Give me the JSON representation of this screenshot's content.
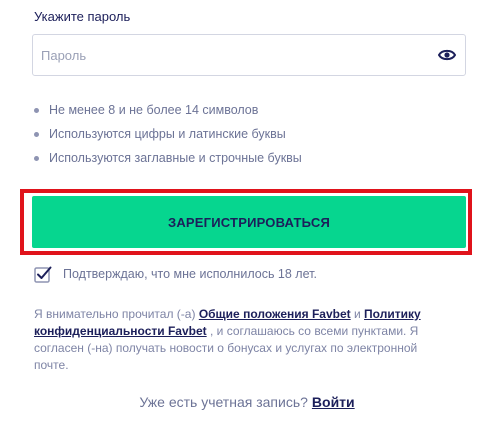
{
  "password": {
    "label": "Укажите пароль",
    "placeholder": "Пароль",
    "value": "",
    "toggle_icon": "eye-icon"
  },
  "rules": [
    "Не менее 8 и не более 14 символов",
    "Используются цифры и латинские буквы",
    "Используются заглавные и строчные буквы"
  ],
  "register_button": {
    "label": "ЗАРЕГИСТРИРОВАТЬСЯ",
    "color": "#06d68f",
    "highlight_color": "#e0131b"
  },
  "age_confirm": {
    "label": "Подтверждаю, что мне исполнилось 18 лет.",
    "checked": true
  },
  "terms": {
    "prefix": "Я внимательно прочитал (-а)",
    "link1": "Общие положения Favbet",
    "and": "и",
    "link2": "Политику конфиденциальности Favbet",
    "suffix": ", и соглашаюсь со всеми пунктами. Я согласен (-на) получать новости о бонусах и услугах по электронной почте."
  },
  "login": {
    "question": "Уже есть учетная запись?",
    "link": "Войти"
  },
  "colors": {
    "text_dark": "#1c1f5a",
    "text_muted": "#6c7396"
  }
}
